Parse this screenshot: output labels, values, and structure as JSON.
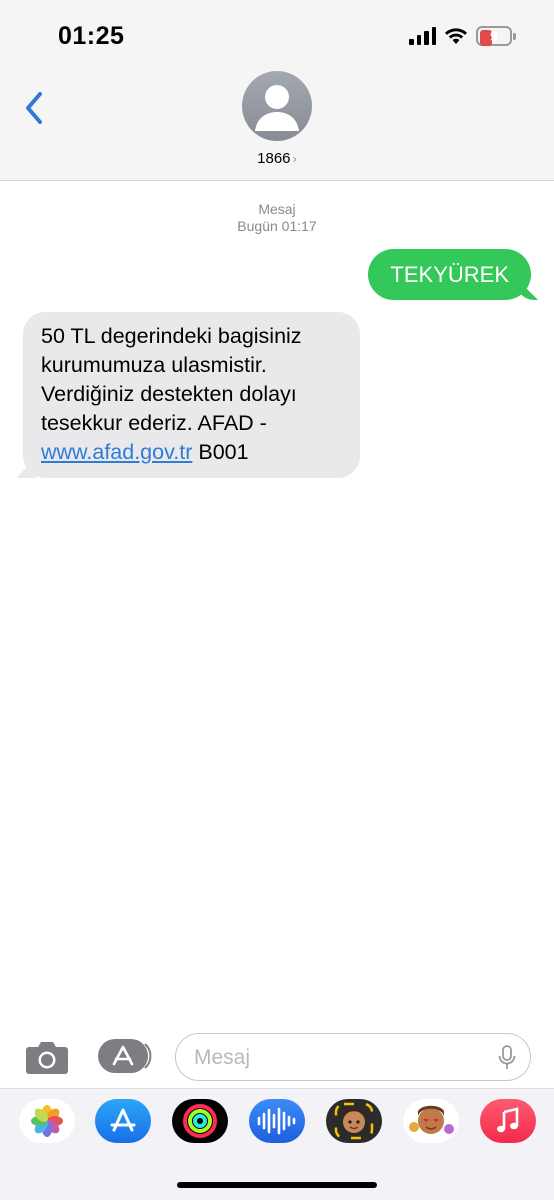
{
  "status_bar": {
    "time": "01:25",
    "battery_level": "9",
    "battery_color": "#e2494a"
  },
  "header": {
    "contact_name": "1866",
    "back_icon": "chevron-left-icon",
    "avatar_icon": "person-silhouette-icon"
  },
  "conversation": {
    "service_label": "Mesaj",
    "timestamp": "Bugün 01:17",
    "outgoing": {
      "text": "TEKYÜREK",
      "color": "#34c759"
    },
    "incoming": {
      "text_before_link": "50 TL degerindeki bagisiniz kurumumuza ulasmistir. Verdiğiniz destekten dolayı tesekkur ederiz. AFAD - ",
      "link": "www.afad.gov.tr",
      "text_after_link": " B001",
      "link_color": "#2f7bd8"
    }
  },
  "input_bar": {
    "placeholder": "Mesaj",
    "camera_icon": "camera-icon",
    "apps_icon": "app-store-icon",
    "mic_icon": "microphone-icon"
  },
  "app_drawer": {
    "apps": [
      "photos-icon",
      "app-store-icon",
      "activity-icon",
      "audio-message-icon",
      "memoji-icon",
      "memoji-stickers-icon",
      "music-icon"
    ]
  }
}
